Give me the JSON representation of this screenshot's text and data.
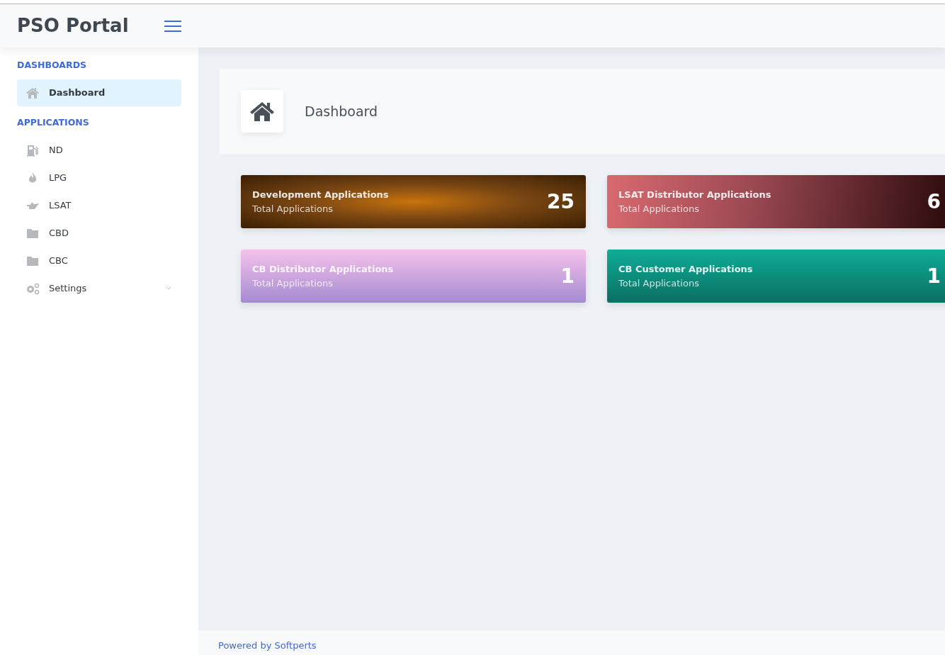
{
  "header": {
    "brand": "PSO Portal"
  },
  "sidebar": {
    "sections": [
      {
        "heading": "DASHBOARDS",
        "items": [
          {
            "label": "Dashboard",
            "selected": true
          }
        ]
      },
      {
        "heading": "APPLICATIONS",
        "items": [
          {
            "label": "ND",
            "selected": false
          },
          {
            "label": "LPG",
            "selected": false
          },
          {
            "label": "LSAT",
            "selected": false
          },
          {
            "label": "CBD",
            "selected": false
          },
          {
            "label": "CBC",
            "selected": false
          },
          {
            "label": "Settings",
            "selected": false,
            "expanded": false
          }
        ]
      }
    ]
  },
  "page_title": "Dashboard",
  "cards": [
    {
      "title": "Development Applications",
      "subtitle": "Total Applications",
      "count": "25",
      "kind": "amber"
    },
    {
      "title": "LSAT Distributor Applications",
      "subtitle": "Total Applications",
      "count": "6",
      "kind": "rose"
    },
    {
      "title": "CB Distributor Applications",
      "subtitle": "Total Applications",
      "count": "1",
      "kind": "lilac"
    },
    {
      "title": "CB Customer Applications",
      "subtitle": "Total Applications",
      "count": "1",
      "kind": "teal"
    }
  ],
  "footer": {
    "link": "Powered by Softperts"
  }
}
